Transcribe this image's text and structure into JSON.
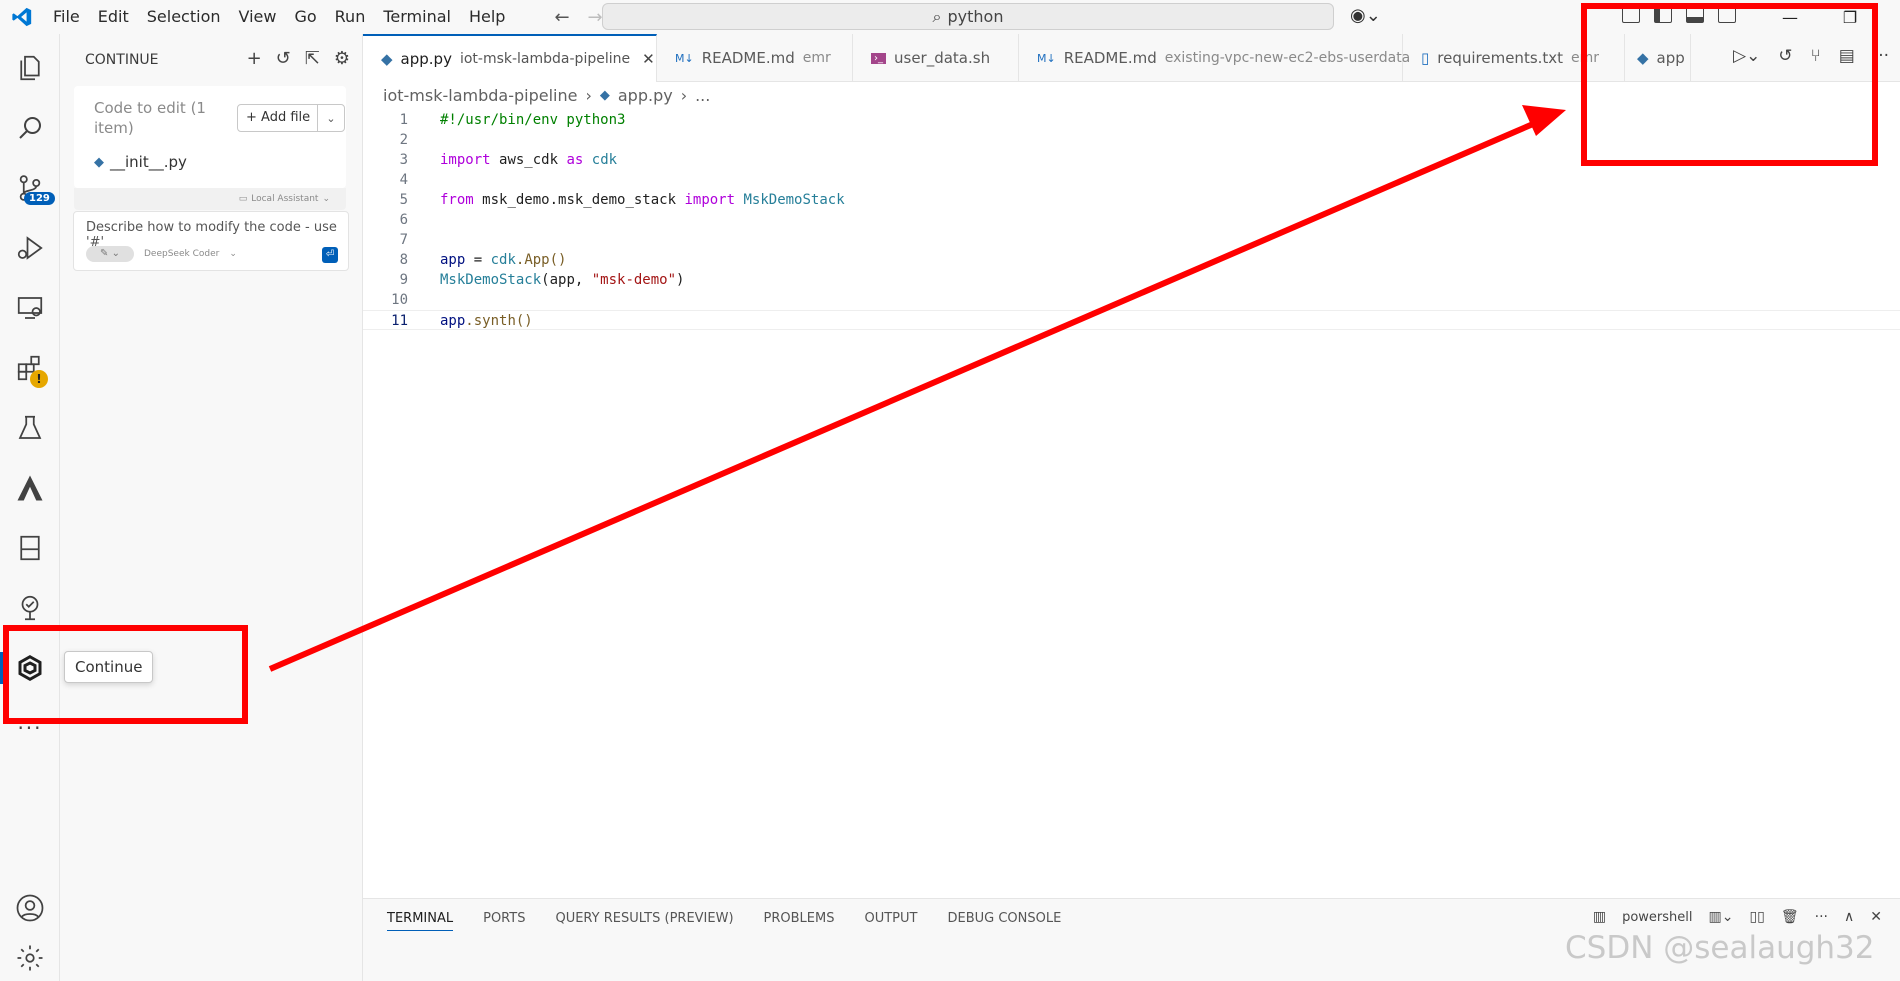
{
  "menu": [
    "File",
    "Edit",
    "Selection",
    "View",
    "Go",
    "Run",
    "Terminal",
    "Help"
  ],
  "search": {
    "text": "python"
  },
  "sidebar_panel": {
    "title": "CONTINUE",
    "card_title": "Code to edit (1 item)",
    "add_file": "+ Add file",
    "file": "__init__.py",
    "local_assistant": "Local Assistant",
    "prompt_placeholder": "Describe how to modify the code - use '#'",
    "model": "DeepSeek Coder"
  },
  "activity": {
    "scm_badge": "129",
    "tooltip": "Continue"
  },
  "tabs": [
    {
      "name": "app.py",
      "desc": "iot-msk-lambda-pipeline",
      "icon": "python-icon"
    },
    {
      "name": "README.md",
      "desc": "emr",
      "icon": "markdown-icon"
    },
    {
      "name": "user_data.sh",
      "desc": "",
      "icon": "shell-icon"
    },
    {
      "name": "README.md",
      "desc": "existing-vpc-new-ec2-ebs-userdata",
      "icon": "markdown-icon"
    },
    {
      "name": "requirements.txt",
      "desc": "emr",
      "icon": "file-icon"
    },
    {
      "name": "app",
      "desc": "",
      "icon": "python-icon"
    }
  ],
  "breadcrumb": {
    "folder": "iot-msk-lambda-pipeline",
    "file": "app.py",
    "more": "..."
  },
  "code_lines": [
    "1",
    "2",
    "3",
    "4",
    "5",
    "6",
    "7",
    "8",
    "9",
    "10",
    "11"
  ],
  "code": {
    "l1": "#!/usr/bin/env python3",
    "l3_kw": "import",
    "l3_mod": "aws_cdk",
    "l3_as": "as",
    "l3_alias": "cdk",
    "l5_from": "from",
    "l5_mod": "msk_demo.msk_demo_stack",
    "l5_import": "import",
    "l5_cls": "MskDemoStack",
    "l8_var": "app",
    "l8_eq": " = ",
    "l8_mod": "cdk",
    "l8_call": ".App()",
    "l9_cls": "MskDemoStack",
    "l9_args_open": "(app, ",
    "l9_str": "\"msk-demo\"",
    "l9_close": ")",
    "l11_var": "app",
    "l11_call": ".synth()"
  },
  "bottom_panel": {
    "tabs": [
      "TERMINAL",
      "PORTS",
      "QUERY RESULTS (PREVIEW)",
      "PROBLEMS",
      "OUTPUT",
      "DEBUG CONSOLE"
    ],
    "shell": "powershell"
  },
  "watermark": "CSDN @sealaugh32",
  "colors": {
    "accent": "#005fb8",
    "annotation": "#ff0000"
  }
}
